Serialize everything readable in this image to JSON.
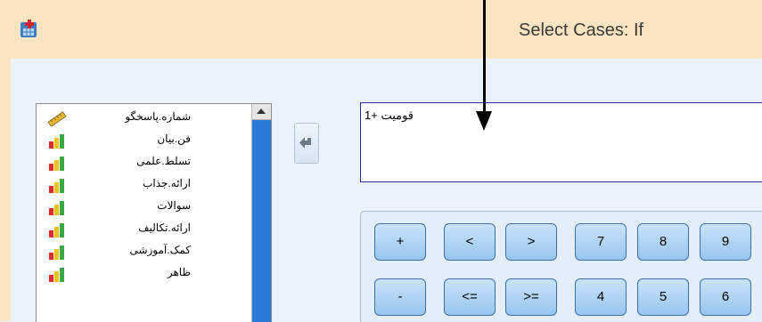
{
  "window": {
    "title": "Select Cases: If",
    "app_icon": "spss-app-icon"
  },
  "variables": [
    {
      "label": "شماره.پاسخگو",
      "icon": "scale-ruler-icon"
    },
    {
      "label": "فن.بیان",
      "icon": "ordinal-bar-icon"
    },
    {
      "label": "تسلط.علمی",
      "icon": "ordinal-bar-icon"
    },
    {
      "label": "ارائه.جذاب",
      "icon": "ordinal-bar-icon"
    },
    {
      "label": "سوالات",
      "icon": "ordinal-bar-icon"
    },
    {
      "label": "ارائه.تکالیف",
      "icon": "ordinal-bar-icon"
    },
    {
      "label": "کمک.آموزشی",
      "icon": "ordinal-bar-icon"
    },
    {
      "label": "ظاهر",
      "icon": "ordinal-bar-icon"
    }
  ],
  "move_button": {
    "icon": "arrow-left-icon"
  },
  "expression": {
    "text": "قومیت +1"
  },
  "keypad": {
    "row1": [
      "+",
      "<",
      ">",
      "7",
      "8",
      "9"
    ],
    "row2": [
      "-",
      "<=",
      ">=",
      "4",
      "5",
      "6"
    ]
  },
  "annotation": {
    "icon": "annotation-arrow-down"
  }
}
